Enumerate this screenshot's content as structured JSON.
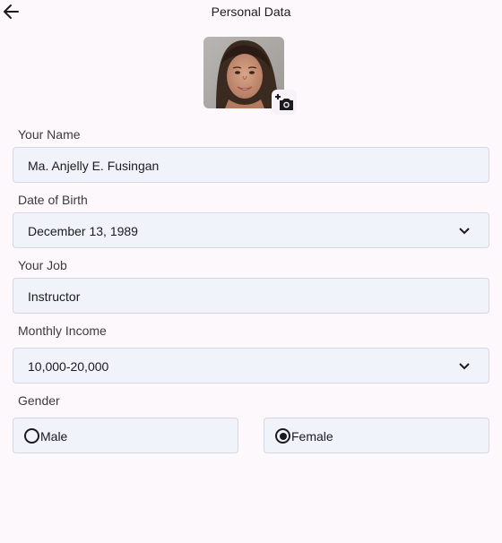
{
  "header": {
    "title": "Personal Data"
  },
  "icons": {
    "back": "arrow-left",
    "photo": "person-photo",
    "add_photo": "add-a-photo-camera"
  },
  "form": {
    "name": {
      "label": "Your Name",
      "value": "Ma. Anjelly E. Fusingan"
    },
    "dob": {
      "label": "Date of Birth",
      "value": "December 13, 1989"
    },
    "job": {
      "label": "Your Job",
      "value": "Instructor"
    },
    "income": {
      "label": "Monthly Income",
      "value": "10,000-20,000"
    },
    "gender": {
      "label": "Gender",
      "options": [
        {
          "label": "Male",
          "selected": false
        },
        {
          "label": "Female",
          "selected": true
        }
      ]
    }
  },
  "colors": {
    "background": "#fdf8fc",
    "field_fill": "#f1f3fb",
    "field_border": "#d5d8e2",
    "text": "#1b1b1f"
  }
}
